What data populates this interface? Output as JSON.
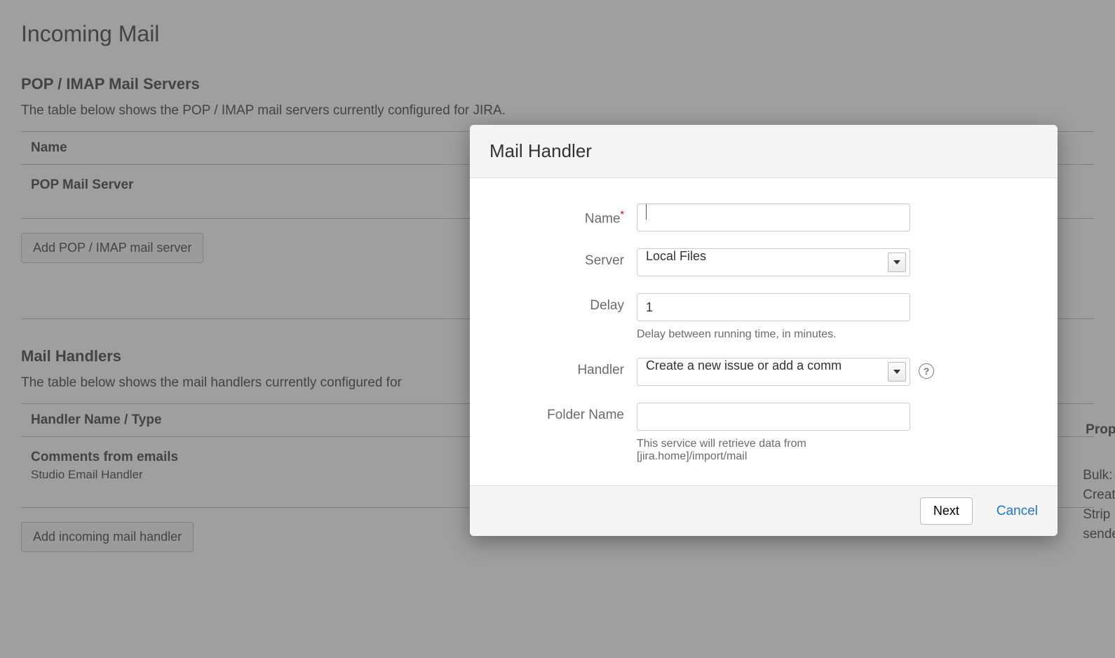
{
  "page": {
    "title": "Incoming Mail"
  },
  "servers_section": {
    "title": "POP / IMAP Mail Servers",
    "description": "The table below shows the POP / IMAP mail servers currently configured for JIRA.",
    "columns": {
      "name": "Name"
    },
    "rows": [
      {
        "name": "POP Mail Server"
      }
    ],
    "add_button": "Add POP / IMAP mail server"
  },
  "handlers_section": {
    "title": "Mail Handlers",
    "description": "The table below shows the mail handlers currently configured for",
    "columns": {
      "name": "Handler Name / Type",
      "props": "Props"
    },
    "rows": [
      {
        "name": "Comments from emails",
        "type": "Studio Email Handler",
        "props_lines": [
          "Bulk:",
          "Creat",
          "Strip",
          "sende"
        ]
      }
    ],
    "add_button": "Add incoming mail handler"
  },
  "modal": {
    "title": "Mail Handler",
    "fields": {
      "name": {
        "label": "Name",
        "required": true,
        "value": ""
      },
      "server": {
        "label": "Server",
        "value": "Local Files"
      },
      "delay": {
        "label": "Delay",
        "value": "1",
        "help": "Delay between running time, in minutes."
      },
      "handler": {
        "label": "Handler",
        "value": "Create a new issue or add a comm"
      },
      "folder": {
        "label": "Folder Name",
        "value": "",
        "help": "This service will retrieve data from [jira.home]/import/mail"
      }
    },
    "buttons": {
      "next": "Next",
      "cancel": "Cancel"
    }
  }
}
